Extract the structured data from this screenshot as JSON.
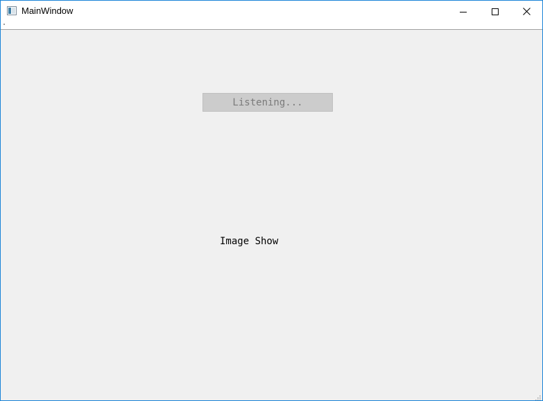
{
  "window": {
    "title": "MainWindow",
    "accent_border": "#1883d7"
  },
  "titlebar": {
    "icons": {
      "app": "app-window-icon",
      "minimize": "minimize-icon",
      "maximize": "maximize-icon",
      "close": "close-icon"
    }
  },
  "main": {
    "listen_button": {
      "label": "Listening...",
      "enabled": false
    },
    "image_label": "Image Show"
  }
}
